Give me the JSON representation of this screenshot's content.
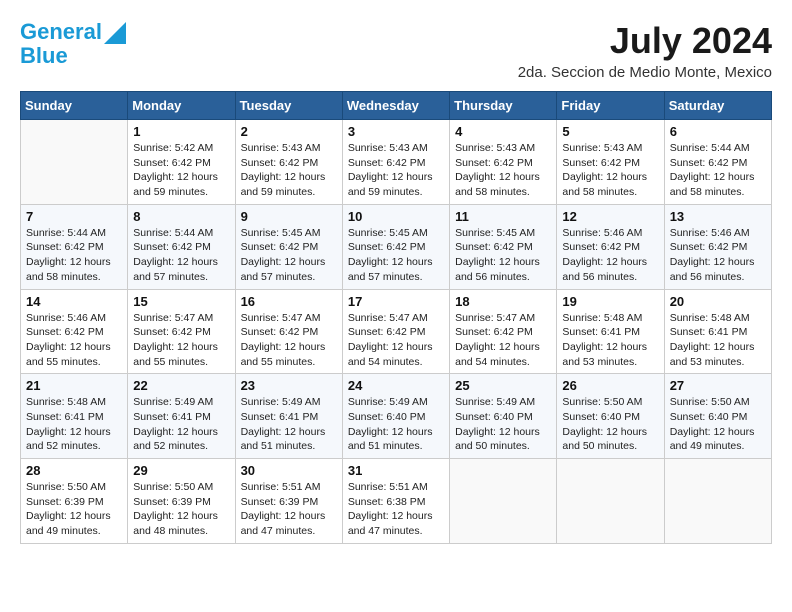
{
  "header": {
    "logo_line1": "General",
    "logo_line2": "Blue",
    "month_year": "July 2024",
    "subtitle": "2da. Seccion de Medio Monte, Mexico"
  },
  "days_of_week": [
    "Sunday",
    "Monday",
    "Tuesday",
    "Wednesday",
    "Thursday",
    "Friday",
    "Saturday"
  ],
  "weeks": [
    [
      {
        "day": "",
        "info": ""
      },
      {
        "day": "1",
        "info": "Sunrise: 5:42 AM\nSunset: 6:42 PM\nDaylight: 12 hours\nand 59 minutes."
      },
      {
        "day": "2",
        "info": "Sunrise: 5:43 AM\nSunset: 6:42 PM\nDaylight: 12 hours\nand 59 minutes."
      },
      {
        "day": "3",
        "info": "Sunrise: 5:43 AM\nSunset: 6:42 PM\nDaylight: 12 hours\nand 59 minutes."
      },
      {
        "day": "4",
        "info": "Sunrise: 5:43 AM\nSunset: 6:42 PM\nDaylight: 12 hours\nand 58 minutes."
      },
      {
        "day": "5",
        "info": "Sunrise: 5:43 AM\nSunset: 6:42 PM\nDaylight: 12 hours\nand 58 minutes."
      },
      {
        "day": "6",
        "info": "Sunrise: 5:44 AM\nSunset: 6:42 PM\nDaylight: 12 hours\nand 58 minutes."
      }
    ],
    [
      {
        "day": "7",
        "info": "Sunrise: 5:44 AM\nSunset: 6:42 PM\nDaylight: 12 hours\nand 58 minutes."
      },
      {
        "day": "8",
        "info": "Sunrise: 5:44 AM\nSunset: 6:42 PM\nDaylight: 12 hours\nand 57 minutes."
      },
      {
        "day": "9",
        "info": "Sunrise: 5:45 AM\nSunset: 6:42 PM\nDaylight: 12 hours\nand 57 minutes."
      },
      {
        "day": "10",
        "info": "Sunrise: 5:45 AM\nSunset: 6:42 PM\nDaylight: 12 hours\nand 57 minutes."
      },
      {
        "day": "11",
        "info": "Sunrise: 5:45 AM\nSunset: 6:42 PM\nDaylight: 12 hours\nand 56 minutes."
      },
      {
        "day": "12",
        "info": "Sunrise: 5:46 AM\nSunset: 6:42 PM\nDaylight: 12 hours\nand 56 minutes."
      },
      {
        "day": "13",
        "info": "Sunrise: 5:46 AM\nSunset: 6:42 PM\nDaylight: 12 hours\nand 56 minutes."
      }
    ],
    [
      {
        "day": "14",
        "info": "Sunrise: 5:46 AM\nSunset: 6:42 PM\nDaylight: 12 hours\nand 55 minutes."
      },
      {
        "day": "15",
        "info": "Sunrise: 5:47 AM\nSunset: 6:42 PM\nDaylight: 12 hours\nand 55 minutes."
      },
      {
        "day": "16",
        "info": "Sunrise: 5:47 AM\nSunset: 6:42 PM\nDaylight: 12 hours\nand 55 minutes."
      },
      {
        "day": "17",
        "info": "Sunrise: 5:47 AM\nSunset: 6:42 PM\nDaylight: 12 hours\nand 54 minutes."
      },
      {
        "day": "18",
        "info": "Sunrise: 5:47 AM\nSunset: 6:42 PM\nDaylight: 12 hours\nand 54 minutes."
      },
      {
        "day": "19",
        "info": "Sunrise: 5:48 AM\nSunset: 6:41 PM\nDaylight: 12 hours\nand 53 minutes."
      },
      {
        "day": "20",
        "info": "Sunrise: 5:48 AM\nSunset: 6:41 PM\nDaylight: 12 hours\nand 53 minutes."
      }
    ],
    [
      {
        "day": "21",
        "info": "Sunrise: 5:48 AM\nSunset: 6:41 PM\nDaylight: 12 hours\nand 52 minutes."
      },
      {
        "day": "22",
        "info": "Sunrise: 5:49 AM\nSunset: 6:41 PM\nDaylight: 12 hours\nand 52 minutes."
      },
      {
        "day": "23",
        "info": "Sunrise: 5:49 AM\nSunset: 6:41 PM\nDaylight: 12 hours\nand 51 minutes."
      },
      {
        "day": "24",
        "info": "Sunrise: 5:49 AM\nSunset: 6:40 PM\nDaylight: 12 hours\nand 51 minutes."
      },
      {
        "day": "25",
        "info": "Sunrise: 5:49 AM\nSunset: 6:40 PM\nDaylight: 12 hours\nand 50 minutes."
      },
      {
        "day": "26",
        "info": "Sunrise: 5:50 AM\nSunset: 6:40 PM\nDaylight: 12 hours\nand 50 minutes."
      },
      {
        "day": "27",
        "info": "Sunrise: 5:50 AM\nSunset: 6:40 PM\nDaylight: 12 hours\nand 49 minutes."
      }
    ],
    [
      {
        "day": "28",
        "info": "Sunrise: 5:50 AM\nSunset: 6:39 PM\nDaylight: 12 hours\nand 49 minutes."
      },
      {
        "day": "29",
        "info": "Sunrise: 5:50 AM\nSunset: 6:39 PM\nDaylight: 12 hours\nand 48 minutes."
      },
      {
        "day": "30",
        "info": "Sunrise: 5:51 AM\nSunset: 6:39 PM\nDaylight: 12 hours\nand 47 minutes."
      },
      {
        "day": "31",
        "info": "Sunrise: 5:51 AM\nSunset: 6:38 PM\nDaylight: 12 hours\nand 47 minutes."
      },
      {
        "day": "",
        "info": ""
      },
      {
        "day": "",
        "info": ""
      },
      {
        "day": "",
        "info": ""
      }
    ]
  ]
}
